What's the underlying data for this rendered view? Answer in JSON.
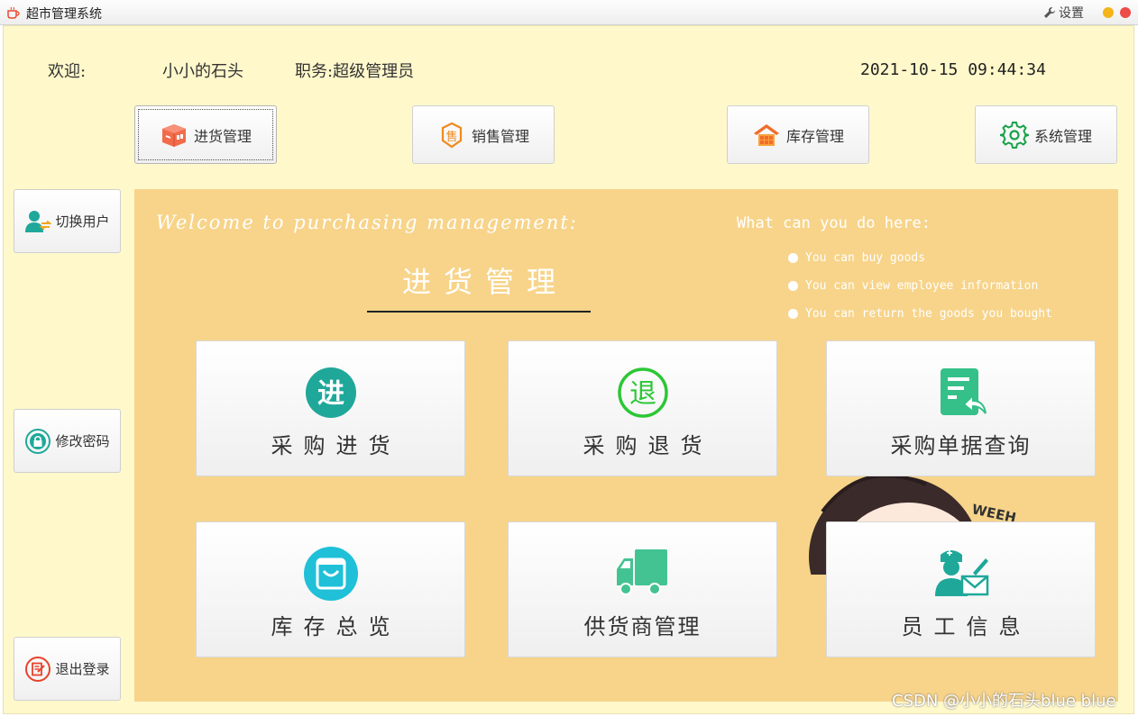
{
  "window": {
    "title": "超市管理系统",
    "settings_label": "设置"
  },
  "header": {
    "welcome_label": "欢迎:",
    "user_name": "小小的石头",
    "role_text": "职务:超级管理员",
    "datetime": "2021-10-15 09:44:34"
  },
  "nav": {
    "items": [
      {
        "label": "进货管理",
        "icon": "package-icon",
        "active": true
      },
      {
        "label": "销售管理",
        "icon": "sale-tag-icon"
      },
      {
        "label": "库存管理",
        "icon": "warehouse-icon"
      },
      {
        "label": "系统管理",
        "icon": "gear-icon"
      }
    ]
  },
  "sidebar": {
    "items": [
      {
        "label": "切换用户",
        "icon": "switch-user-icon"
      },
      {
        "label": "修改密码",
        "icon": "lock-icon"
      },
      {
        "label": "退出登录",
        "icon": "logout-icon"
      }
    ]
  },
  "panel": {
    "welcome": "Welcome to purchasing management:",
    "title": "进货管理",
    "help_heading": "What can you do here:",
    "help_items": [
      "You can buy goods",
      "You can view employee information",
      "You can return the goods you bought"
    ],
    "mascot_text": "WEEH"
  },
  "tiles": [
    {
      "label": "采购进货",
      "icon": "purchase-in-icon",
      "glyph": "进"
    },
    {
      "label": "采购退货",
      "icon": "purchase-return-icon",
      "glyph": "退"
    },
    {
      "label": "采购单据查询",
      "icon": "document-query-icon"
    },
    {
      "label": "库存总览",
      "icon": "shopping-bag-icon"
    },
    {
      "label": "供货商管理",
      "icon": "truck-icon"
    },
    {
      "label": "员工信息",
      "icon": "employee-icon"
    }
  ],
  "watermark": "CSDN @小小的石头blue blue",
  "colors": {
    "background": "#fff8cb",
    "panel": "#f7d48a",
    "teal": "#1fa89a",
    "green": "#2cc735",
    "orange": "#f26b2a"
  }
}
